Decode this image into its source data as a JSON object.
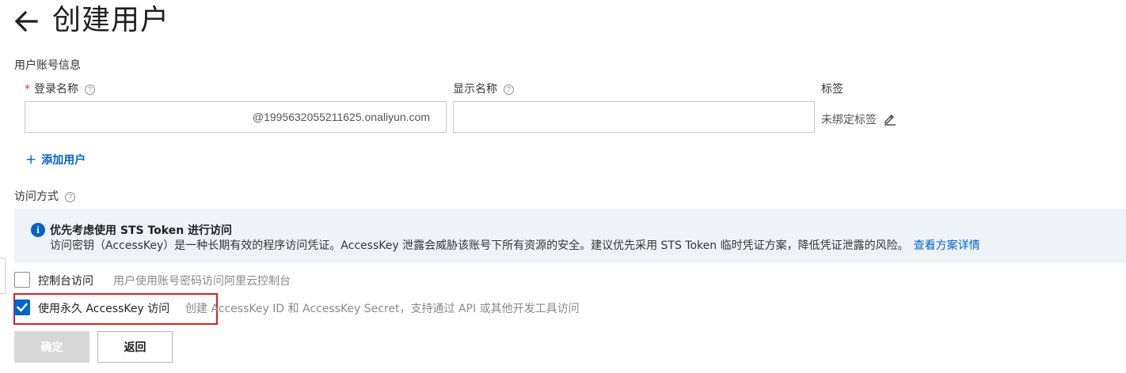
{
  "header": {
    "title": "创建用户",
    "back_icon": "arrow-left-icon"
  },
  "account_section": {
    "title": "用户账号信息",
    "login_name": {
      "required_mark": "*",
      "label": "登录名称",
      "value": "",
      "suffix": "@1995632055211625.onaliyun.com"
    },
    "display_name": {
      "label": "显示名称",
      "value": ""
    },
    "tags": {
      "label": "标签",
      "value": "未绑定标签",
      "edit_icon": "edit-icon"
    },
    "add_user": {
      "plus": "+",
      "label": "添加用户"
    }
  },
  "access_section": {
    "title": "访问方式",
    "help_glyph": "?",
    "notice": {
      "icon": "info-icon",
      "icon_glyph": "i",
      "title": "优先考虑使用 STS Token 进行访问",
      "body": "访问密钥（AccessKey）是一种长期有效的程序访问凭证。AccessKey 泄露会威胁该账号下所有资源的安全。建议优先采用 STS Token 临时凭证方案，降低凭证泄露的风险。",
      "link": "查看方案详情"
    },
    "options": [
      {
        "label": "控制台访问",
        "description": "用户使用账号密码访问阿里云控制台",
        "checked": false
      },
      {
        "label": "使用永久 AccessKey 访问",
        "description": "创建 AccessKey ID 和 AccessKey Secret，支持通过 API 或其他开发工具访问",
        "checked": true
      }
    ]
  },
  "actions": {
    "confirm_label": "确定",
    "back_label": "返回"
  },
  "colors": {
    "accent": "#0064c8",
    "required": "#e3382b",
    "highlight_border": "#d9201f",
    "notice_bg": "#eff3f8",
    "disabled_button": "#d7d7d7"
  }
}
